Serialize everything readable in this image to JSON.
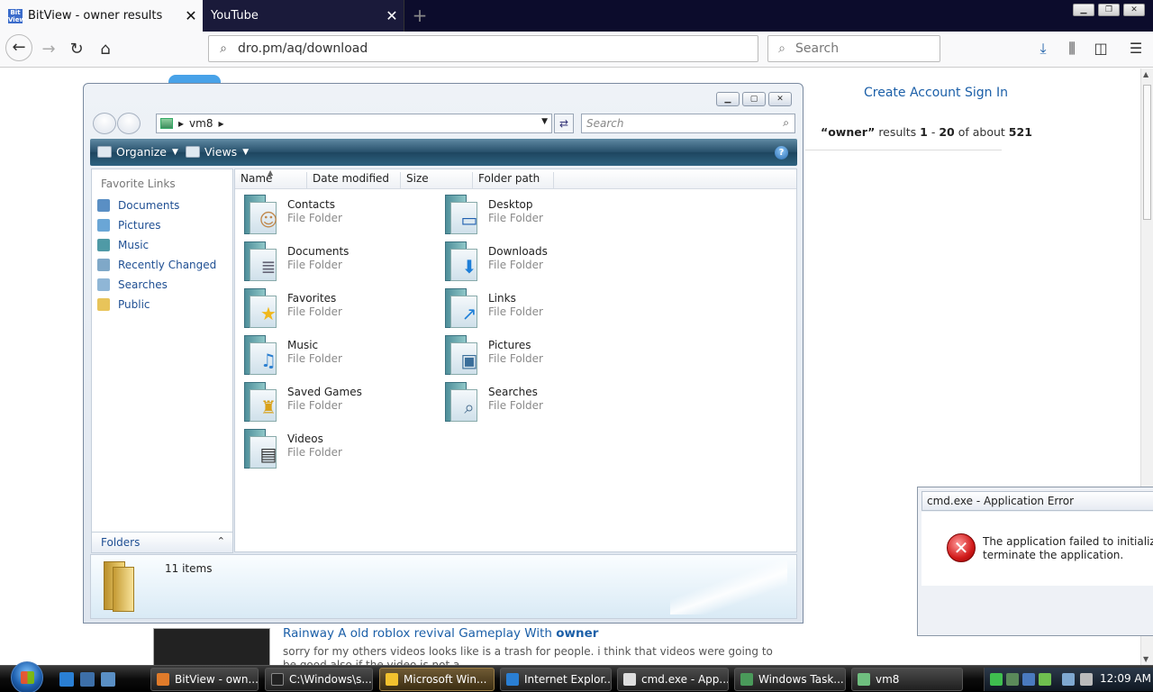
{
  "browser": {
    "tabs": [
      {
        "title": "BitView - owner results",
        "favicon": "Bit View"
      },
      {
        "title": "YouTube"
      }
    ],
    "new_tab_symbol": "+",
    "close_symbol": "✕",
    "url": "dro.pm/aq/download",
    "search_placeholder": "Search"
  },
  "page": {
    "create_account": "Create Account",
    "sign_in": "Sign In",
    "results": {
      "query": "“owner”",
      "text1": " results ",
      "from": "1",
      "dash": " - ",
      "to": "20",
      "text2": " of about ",
      "total": "521"
    },
    "video": {
      "title_prefix": "Rainway A old roblox revival Gameplay With ",
      "title_highlight": "owner",
      "description": "sorry for my others videos looks like is a trash for people. i think that videos were going to be good also if the video is not a"
    }
  },
  "explorer": {
    "address_crumb": "vm8",
    "search_placeholder": "Search",
    "organize_label": "Organize",
    "views_label": "Views",
    "help_symbol": "?",
    "favorite_links_header": "Favorite Links",
    "favorite_links": [
      "Documents",
      "Pictures",
      "Music",
      "Recently Changed",
      "Searches",
      "Public"
    ],
    "folders_label": "Folders",
    "columns": [
      "Name",
      "Date modified",
      "Size",
      "Folder path"
    ],
    "items": [
      {
        "name": "Contacts",
        "type": "File Folder",
        "icon": "contacts-icon"
      },
      {
        "name": "Desktop",
        "type": "File Folder",
        "icon": "desktop-icon"
      },
      {
        "name": "Documents",
        "type": "File Folder",
        "icon": "documents-icon"
      },
      {
        "name": "Downloads",
        "type": "File Folder",
        "icon": "downloads-icon"
      },
      {
        "name": "Favorites",
        "type": "File Folder",
        "icon": "favorites-icon"
      },
      {
        "name": "Links",
        "type": "File Folder",
        "icon": "links-icon"
      },
      {
        "name": "Music",
        "type": "File Folder",
        "icon": "music-icon"
      },
      {
        "name": "Pictures",
        "type": "File Folder",
        "icon": "pictures-icon"
      },
      {
        "name": "Saved Games",
        "type": "File Folder",
        "icon": "saved-games-icon"
      },
      {
        "name": "Searches",
        "type": "File Folder",
        "icon": "searches-icon"
      },
      {
        "name": "Videos",
        "type": "File Folder",
        "icon": "videos-icon"
      }
    ],
    "item_count": "11 items"
  },
  "error_dialog": {
    "title": "cmd.exe - Application Error",
    "message": "The application failed to initialize pro\nterminate the application."
  },
  "taskbar": {
    "buttons": [
      "BitView - own...",
      "C:\\Windows\\s...",
      "Microsoft Win...",
      "Internet Explor...",
      "cmd.exe - App...",
      "Windows Task...",
      "vm8"
    ],
    "clock": "12:09 AM"
  },
  "colors": {
    "link_blue": "#1b5fa8",
    "explorer_link": "#1f4f93",
    "command_bar": "#264f6a",
    "active_task": "#6f5a34"
  }
}
